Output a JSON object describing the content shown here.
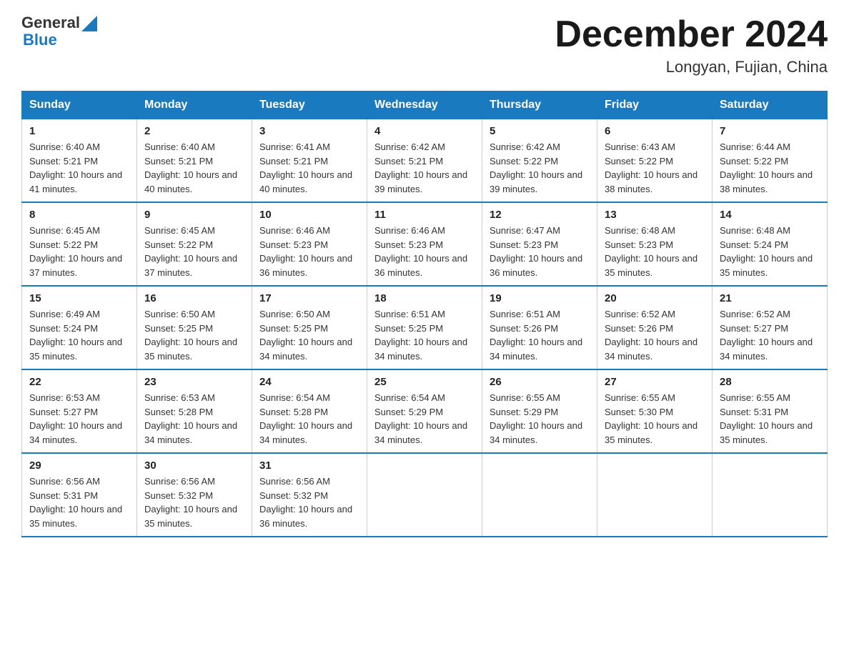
{
  "logo": {
    "general": "General",
    "blue": "Blue"
  },
  "header": {
    "month": "December 2024",
    "location": "Longyan, Fujian, China"
  },
  "weekdays": [
    "Sunday",
    "Monday",
    "Tuesday",
    "Wednesday",
    "Thursday",
    "Friday",
    "Saturday"
  ],
  "weeks": [
    [
      {
        "day": "1",
        "sunrise": "Sunrise: 6:40 AM",
        "sunset": "Sunset: 5:21 PM",
        "daylight": "Daylight: 10 hours and 41 minutes."
      },
      {
        "day": "2",
        "sunrise": "Sunrise: 6:40 AM",
        "sunset": "Sunset: 5:21 PM",
        "daylight": "Daylight: 10 hours and 40 minutes."
      },
      {
        "day": "3",
        "sunrise": "Sunrise: 6:41 AM",
        "sunset": "Sunset: 5:21 PM",
        "daylight": "Daylight: 10 hours and 40 minutes."
      },
      {
        "day": "4",
        "sunrise": "Sunrise: 6:42 AM",
        "sunset": "Sunset: 5:21 PM",
        "daylight": "Daylight: 10 hours and 39 minutes."
      },
      {
        "day": "5",
        "sunrise": "Sunrise: 6:42 AM",
        "sunset": "Sunset: 5:22 PM",
        "daylight": "Daylight: 10 hours and 39 minutes."
      },
      {
        "day": "6",
        "sunrise": "Sunrise: 6:43 AM",
        "sunset": "Sunset: 5:22 PM",
        "daylight": "Daylight: 10 hours and 38 minutes."
      },
      {
        "day": "7",
        "sunrise": "Sunrise: 6:44 AM",
        "sunset": "Sunset: 5:22 PM",
        "daylight": "Daylight: 10 hours and 38 minutes."
      }
    ],
    [
      {
        "day": "8",
        "sunrise": "Sunrise: 6:45 AM",
        "sunset": "Sunset: 5:22 PM",
        "daylight": "Daylight: 10 hours and 37 minutes."
      },
      {
        "day": "9",
        "sunrise": "Sunrise: 6:45 AM",
        "sunset": "Sunset: 5:22 PM",
        "daylight": "Daylight: 10 hours and 37 minutes."
      },
      {
        "day": "10",
        "sunrise": "Sunrise: 6:46 AM",
        "sunset": "Sunset: 5:23 PM",
        "daylight": "Daylight: 10 hours and 36 minutes."
      },
      {
        "day": "11",
        "sunrise": "Sunrise: 6:46 AM",
        "sunset": "Sunset: 5:23 PM",
        "daylight": "Daylight: 10 hours and 36 minutes."
      },
      {
        "day": "12",
        "sunrise": "Sunrise: 6:47 AM",
        "sunset": "Sunset: 5:23 PM",
        "daylight": "Daylight: 10 hours and 36 minutes."
      },
      {
        "day": "13",
        "sunrise": "Sunrise: 6:48 AM",
        "sunset": "Sunset: 5:23 PM",
        "daylight": "Daylight: 10 hours and 35 minutes."
      },
      {
        "day": "14",
        "sunrise": "Sunrise: 6:48 AM",
        "sunset": "Sunset: 5:24 PM",
        "daylight": "Daylight: 10 hours and 35 minutes."
      }
    ],
    [
      {
        "day": "15",
        "sunrise": "Sunrise: 6:49 AM",
        "sunset": "Sunset: 5:24 PM",
        "daylight": "Daylight: 10 hours and 35 minutes."
      },
      {
        "day": "16",
        "sunrise": "Sunrise: 6:50 AM",
        "sunset": "Sunset: 5:25 PM",
        "daylight": "Daylight: 10 hours and 35 minutes."
      },
      {
        "day": "17",
        "sunrise": "Sunrise: 6:50 AM",
        "sunset": "Sunset: 5:25 PM",
        "daylight": "Daylight: 10 hours and 34 minutes."
      },
      {
        "day": "18",
        "sunrise": "Sunrise: 6:51 AM",
        "sunset": "Sunset: 5:25 PM",
        "daylight": "Daylight: 10 hours and 34 minutes."
      },
      {
        "day": "19",
        "sunrise": "Sunrise: 6:51 AM",
        "sunset": "Sunset: 5:26 PM",
        "daylight": "Daylight: 10 hours and 34 minutes."
      },
      {
        "day": "20",
        "sunrise": "Sunrise: 6:52 AM",
        "sunset": "Sunset: 5:26 PM",
        "daylight": "Daylight: 10 hours and 34 minutes."
      },
      {
        "day": "21",
        "sunrise": "Sunrise: 6:52 AM",
        "sunset": "Sunset: 5:27 PM",
        "daylight": "Daylight: 10 hours and 34 minutes."
      }
    ],
    [
      {
        "day": "22",
        "sunrise": "Sunrise: 6:53 AM",
        "sunset": "Sunset: 5:27 PM",
        "daylight": "Daylight: 10 hours and 34 minutes."
      },
      {
        "day": "23",
        "sunrise": "Sunrise: 6:53 AM",
        "sunset": "Sunset: 5:28 PM",
        "daylight": "Daylight: 10 hours and 34 minutes."
      },
      {
        "day": "24",
        "sunrise": "Sunrise: 6:54 AM",
        "sunset": "Sunset: 5:28 PM",
        "daylight": "Daylight: 10 hours and 34 minutes."
      },
      {
        "day": "25",
        "sunrise": "Sunrise: 6:54 AM",
        "sunset": "Sunset: 5:29 PM",
        "daylight": "Daylight: 10 hours and 34 minutes."
      },
      {
        "day": "26",
        "sunrise": "Sunrise: 6:55 AM",
        "sunset": "Sunset: 5:29 PM",
        "daylight": "Daylight: 10 hours and 34 minutes."
      },
      {
        "day": "27",
        "sunrise": "Sunrise: 6:55 AM",
        "sunset": "Sunset: 5:30 PM",
        "daylight": "Daylight: 10 hours and 35 minutes."
      },
      {
        "day": "28",
        "sunrise": "Sunrise: 6:55 AM",
        "sunset": "Sunset: 5:31 PM",
        "daylight": "Daylight: 10 hours and 35 minutes."
      }
    ],
    [
      {
        "day": "29",
        "sunrise": "Sunrise: 6:56 AM",
        "sunset": "Sunset: 5:31 PM",
        "daylight": "Daylight: 10 hours and 35 minutes."
      },
      {
        "day": "30",
        "sunrise": "Sunrise: 6:56 AM",
        "sunset": "Sunset: 5:32 PM",
        "daylight": "Daylight: 10 hours and 35 minutes."
      },
      {
        "day": "31",
        "sunrise": "Sunrise: 6:56 AM",
        "sunset": "Sunset: 5:32 PM",
        "daylight": "Daylight: 10 hours and 36 minutes."
      },
      null,
      null,
      null,
      null
    ]
  ]
}
